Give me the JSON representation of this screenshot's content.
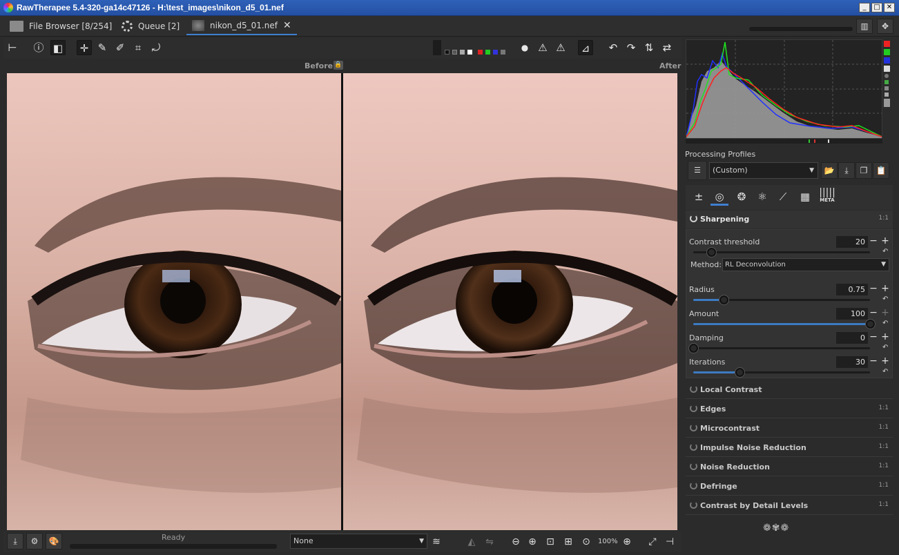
{
  "window": {
    "title": "RawTherapee 5.4-320-ga14c47126 - H:\\test_images\\nikon_d5_01.nef",
    "controls": [
      "_",
      "□",
      "✕"
    ]
  },
  "tabs": [
    {
      "label": "File Browser [8/254]",
      "icon": "folder-icon"
    },
    {
      "label": "Queue [2]",
      "icon": "gear-icon"
    },
    {
      "label": "nikon_d5_01.nef",
      "icon": "image-thumbnail-icon"
    }
  ],
  "preview": {
    "before_label": "Before",
    "after_label": "After"
  },
  "status": {
    "text": "Ready",
    "select_value": "None",
    "zoom": "100%"
  },
  "processing_profiles": {
    "title": "Processing Profiles",
    "value": "(Custom)"
  },
  "tool_tabs": {
    "meta_label": "META"
  },
  "sharpening": {
    "title": "Sharpening",
    "ratio": "1:1",
    "contrast_threshold": {
      "label": "Contrast threshold",
      "value": "20",
      "fraction": 0.1
    },
    "method": {
      "label": "Method:",
      "value": "RL Deconvolution"
    },
    "radius": {
      "label": "Radius",
      "value": "0.75",
      "fraction": 0.17
    },
    "amount": {
      "label": "Amount",
      "value": "100",
      "fraction": 1.0
    },
    "damping": {
      "label": "Damping",
      "value": "0",
      "fraction": 0.0
    },
    "iterations": {
      "label": "Iterations",
      "value": "30",
      "fraction": 0.26
    }
  },
  "sections": [
    {
      "title": "Local Contrast",
      "ratio": ""
    },
    {
      "title": "Edges",
      "ratio": "1:1"
    },
    {
      "title": "Microcontrast",
      "ratio": "1:1"
    },
    {
      "title": "Impulse Noise Reduction",
      "ratio": "1:1"
    },
    {
      "title": "Noise Reduction",
      "ratio": "1:1"
    },
    {
      "title": "Defringe",
      "ratio": "1:1"
    },
    {
      "title": "Contrast by Detail Levels",
      "ratio": "1:1"
    }
  ],
  "colors": {
    "accent": "#3f7fd0",
    "title_bar": "#2f61b9",
    "histogram_red": "#ff2020",
    "histogram_green": "#20e020",
    "histogram_blue": "#2030ff"
  }
}
